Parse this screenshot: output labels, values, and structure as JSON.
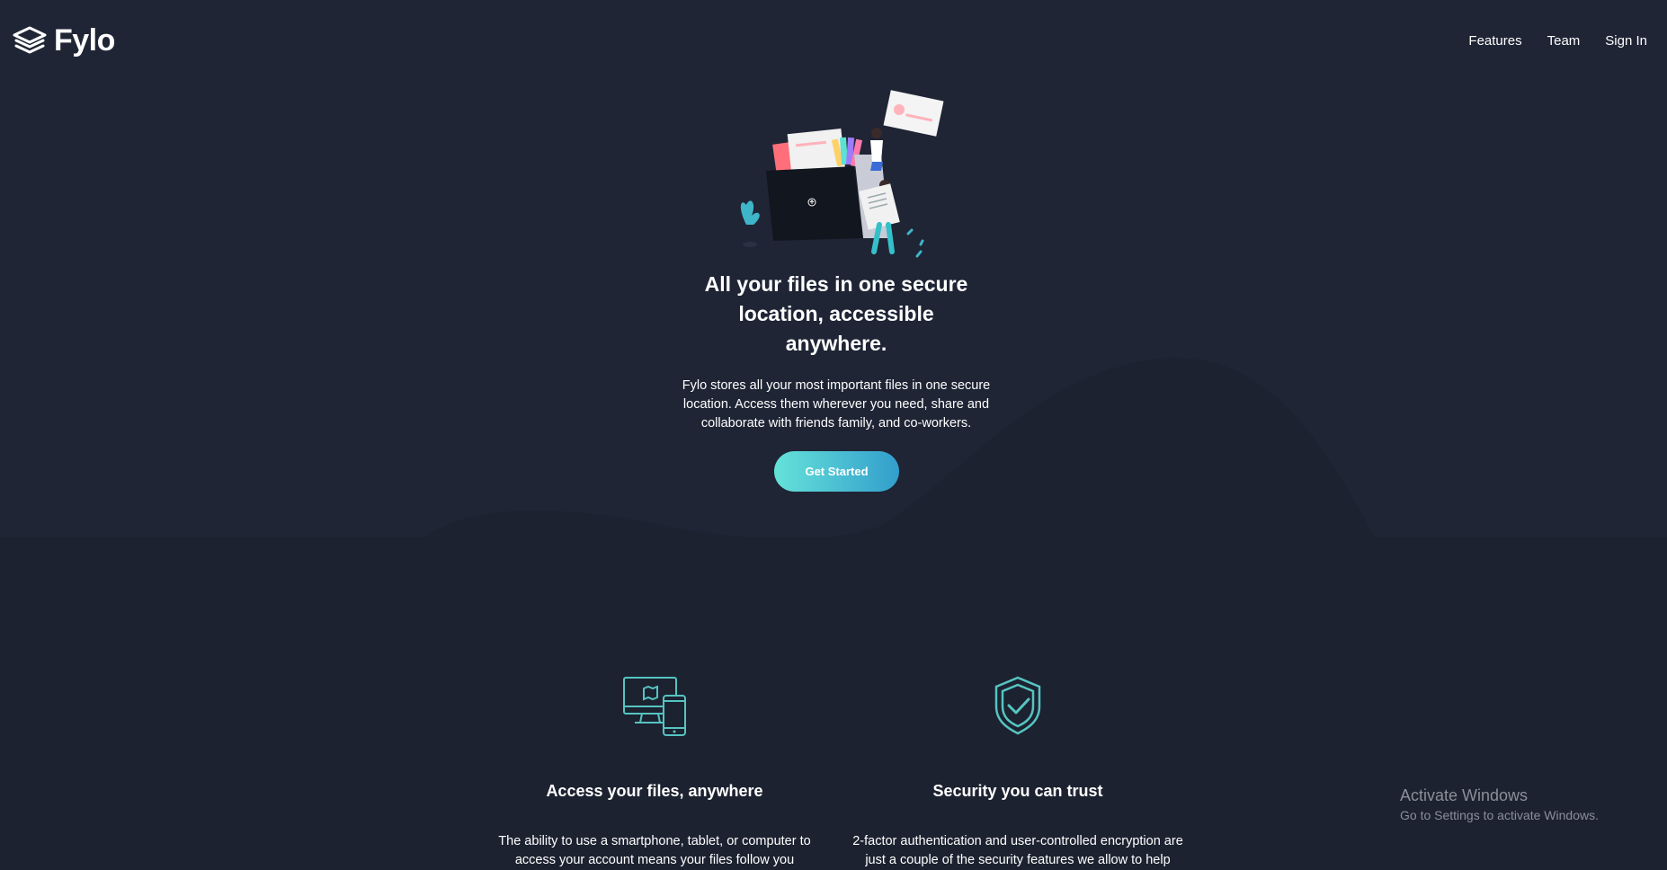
{
  "brand": {
    "name": "Fylo"
  },
  "nav": {
    "items": [
      {
        "label": "Features"
      },
      {
        "label": "Team"
      },
      {
        "label": "Sign In"
      }
    ]
  },
  "hero": {
    "headline_line1": "All your files in one secure",
    "headline_line2": "location, accessible",
    "headline_line3": "anywhere.",
    "sub_line1": "Fylo stores all your most important files in one secure",
    "sub_line2": "location. Access them wherever you need, share and",
    "sub_line3": "collaborate with friends family, and co-workers.",
    "cta_label": "Get Started"
  },
  "features": [
    {
      "icon": "devices-icon",
      "title": "Access your files, anywhere",
      "text_line1": "The ability to use a smartphone, tablet, or computer to",
      "text_line2": "access your account means your files follow you"
    },
    {
      "icon": "shield-check-icon",
      "title": "Security you can trust",
      "text_line1": "2-factor authentication and user-controlled encryption are",
      "text_line2": "just a couple of the security features we allow to help"
    }
  ],
  "watermark": {
    "title": "Activate Windows",
    "subtitle": "Go to Settings to activate Windows."
  },
  "colors": {
    "background": "#1c2230",
    "hero_background": "#1f2535",
    "accent_start": "#65e2d9",
    "accent_end": "#339ecc"
  }
}
